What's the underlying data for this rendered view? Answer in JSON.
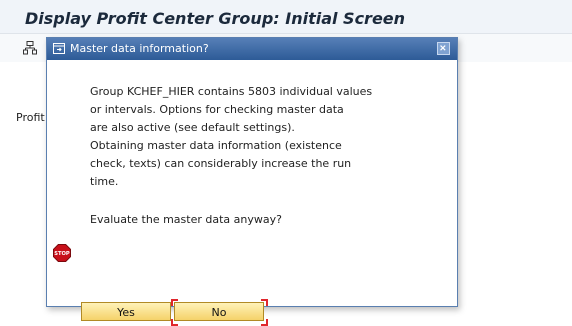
{
  "window": {
    "title": "Display Profit Center Group: Initial Screen"
  },
  "main": {
    "profit_label": "Profit Center Group"
  },
  "dialog": {
    "title": "Master data information?",
    "message_lines": [
      "Group KCHEF_HIER contains 5803 individual values",
      "or intervals. Options for checking master data",
      "are also active (see default settings).",
      "Obtaining master data information (existence",
      "check, texts) can considerably increase the run",
      "time."
    ],
    "question": "Evaluate the master data anyway?",
    "yes_label": "Yes",
    "no_label": "No",
    "stop_icon_text": "STOP"
  },
  "colors": {
    "dialog_header": "#2d5b97",
    "button": "#f5d26a",
    "stop": "#c8101a",
    "focus_frame": "#e0262c"
  }
}
